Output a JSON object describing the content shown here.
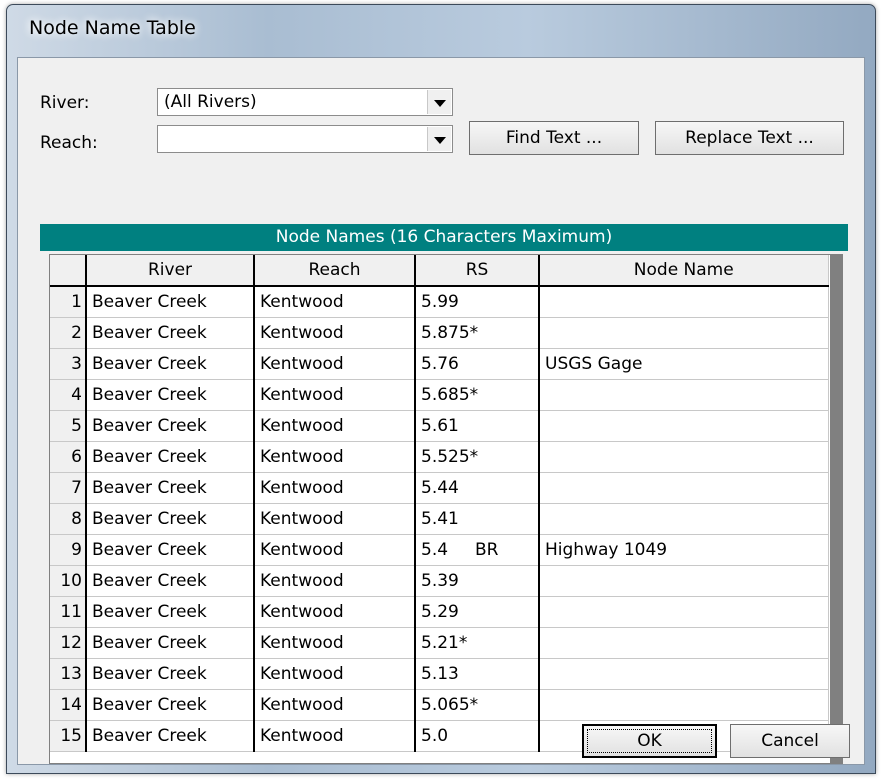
{
  "window": {
    "title": "Node Name Table"
  },
  "filters": {
    "river_label": "River:",
    "river_value": "(All Rivers)",
    "reach_label": "Reach:",
    "reach_value": ""
  },
  "buttons": {
    "find_text": "Find Text ...",
    "replace_text": "Replace Text ...",
    "ok": "OK",
    "cancel": "Cancel"
  },
  "table": {
    "banner": "Node Names (16 Characters Maximum)",
    "columns": [
      "",
      "River",
      "Reach",
      "RS",
      "Node Name"
    ],
    "rows": [
      {
        "n": "1",
        "river": "Beaver Creek",
        "reach": "Kentwood",
        "rs": "5.99",
        "code": "",
        "name": ""
      },
      {
        "n": "2",
        "river": "Beaver Creek",
        "reach": "Kentwood",
        "rs": "5.875*",
        "code": "",
        "name": ""
      },
      {
        "n": "3",
        "river": "Beaver Creek",
        "reach": "Kentwood",
        "rs": "5.76",
        "code": "",
        "name": "USGS Gage"
      },
      {
        "n": "4",
        "river": "Beaver Creek",
        "reach": "Kentwood",
        "rs": "5.685*",
        "code": "",
        "name": ""
      },
      {
        "n": "5",
        "river": "Beaver Creek",
        "reach": "Kentwood",
        "rs": "5.61",
        "code": "",
        "name": ""
      },
      {
        "n": "6",
        "river": "Beaver Creek",
        "reach": "Kentwood",
        "rs": "5.525*",
        "code": "",
        "name": ""
      },
      {
        "n": "7",
        "river": "Beaver Creek",
        "reach": "Kentwood",
        "rs": "5.44",
        "code": "",
        "name": ""
      },
      {
        "n": "8",
        "river": "Beaver Creek",
        "reach": "Kentwood",
        "rs": "5.41",
        "code": "",
        "name": ""
      },
      {
        "n": "9",
        "river": "Beaver Creek",
        "reach": "Kentwood",
        "rs": "5.4",
        "code": "BR",
        "name": "Highway 1049"
      },
      {
        "n": "10",
        "river": "Beaver Creek",
        "reach": "Kentwood",
        "rs": "5.39",
        "code": "",
        "name": ""
      },
      {
        "n": "11",
        "river": "Beaver Creek",
        "reach": "Kentwood",
        "rs": "5.29",
        "code": "",
        "name": ""
      },
      {
        "n": "12",
        "river": "Beaver Creek",
        "reach": "Kentwood",
        "rs": "5.21*",
        "code": "",
        "name": ""
      },
      {
        "n": "13",
        "river": "Beaver Creek",
        "reach": "Kentwood",
        "rs": "5.13",
        "code": "",
        "name": ""
      },
      {
        "n": "14",
        "river": "Beaver Creek",
        "reach": "Kentwood",
        "rs": "5.065*",
        "code": "",
        "name": ""
      },
      {
        "n": "15",
        "river": "Beaver Creek",
        "reach": "Kentwood",
        "rs": "5.0",
        "code": "",
        "name": ""
      }
    ]
  }
}
